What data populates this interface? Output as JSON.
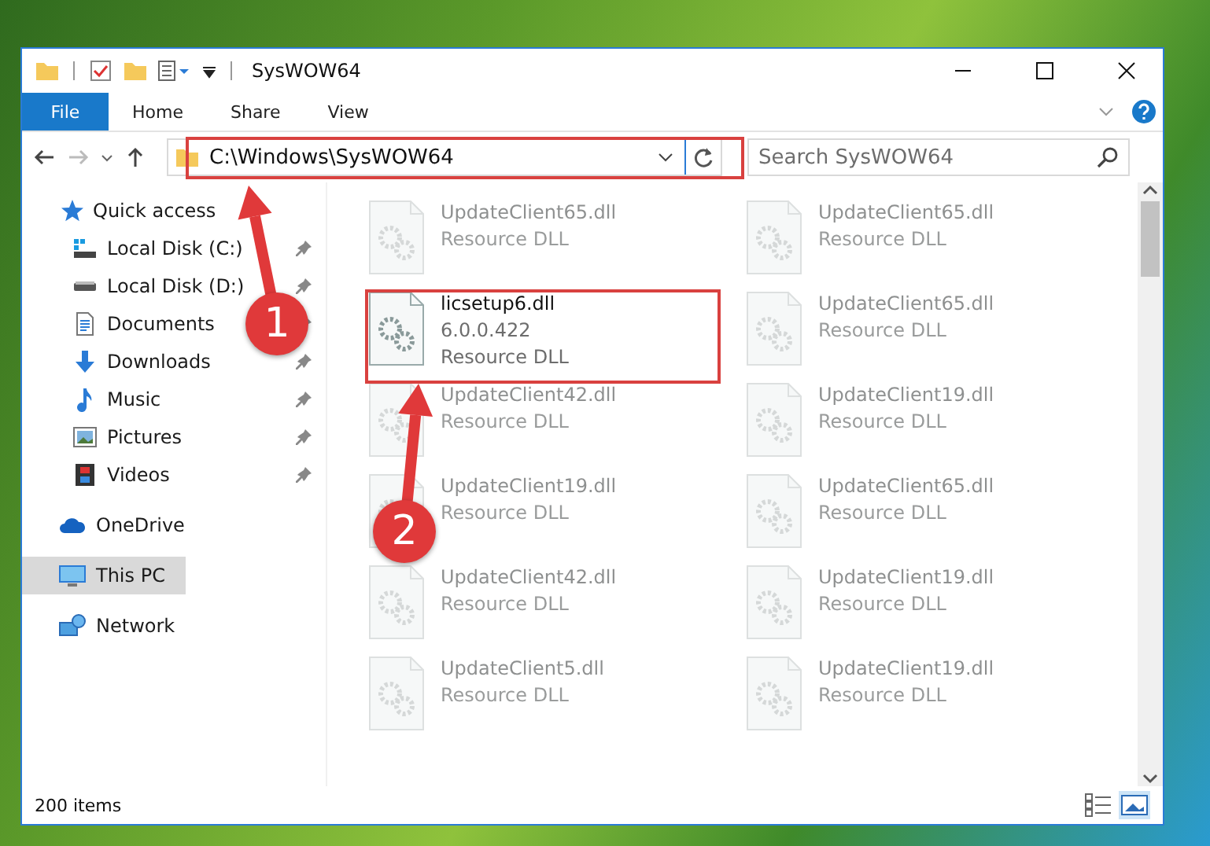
{
  "window": {
    "title": "SysWOW64"
  },
  "ribbon_tabs": [
    {
      "label": "File",
      "kind": "file"
    },
    {
      "label": "Home",
      "kind": "tab"
    },
    {
      "label": "Share",
      "kind": "tab"
    },
    {
      "label": "View",
      "kind": "tab"
    }
  ],
  "address_bar": {
    "path": "C:\\Windows\\SysWOW64"
  },
  "search": {
    "placeholder": "Search SysWOW64"
  },
  "sidebar": {
    "items": [
      {
        "label": "Quick access",
        "kind": "quick-access",
        "selected": false,
        "children": [
          {
            "label": "Local Disk (C:)",
            "kind": "system-drive",
            "pinned": true
          },
          {
            "label": "Local Disk (D:)",
            "kind": "drive",
            "pinned": true
          },
          {
            "label": "Documents",
            "kind": "documents",
            "pinned": true
          },
          {
            "label": "Downloads",
            "kind": "downloads",
            "pinned": true
          },
          {
            "label": "Music",
            "kind": "music",
            "pinned": true
          },
          {
            "label": "Pictures",
            "kind": "pictures",
            "pinned": true
          },
          {
            "label": "Videos",
            "kind": "videos",
            "pinned": true
          }
        ]
      },
      {
        "label": "OneDrive",
        "kind": "cloud",
        "selected": false
      },
      {
        "label": "This PC",
        "kind": "pc",
        "selected": true
      },
      {
        "label": "Network",
        "kind": "network",
        "selected": false
      }
    ]
  },
  "files": [
    {
      "name": "UpdateClient65.dll",
      "type": "Resource DLL",
      "faded": true
    },
    {
      "name": "UpdateClient65.dll",
      "type": "Resource DLL",
      "faded": true
    },
    {
      "name": "licsetup6.dll",
      "version": "6.0.0.422",
      "type": "Resource DLL",
      "faded": false
    },
    {
      "name": "UpdateClient65.dll",
      "type": "Resource DLL",
      "faded": true
    },
    {
      "name": "UpdateClient42.dll",
      "type": "Resource DLL",
      "faded": true
    },
    {
      "name": "UpdateClient19.dll",
      "type": "Resource DLL",
      "faded": true
    },
    {
      "name": "UpdateClient19.dll",
      "type": "Resource DLL",
      "faded": true
    },
    {
      "name": "UpdateClient65.dll",
      "type": "Resource DLL",
      "faded": true
    },
    {
      "name": "UpdateClient42.dll",
      "type": "Resource DLL",
      "faded": true
    },
    {
      "name": "UpdateClient19.dll",
      "type": "Resource DLL",
      "faded": true
    },
    {
      "name": "UpdateClient5.dll",
      "type": "Resource DLL",
      "faded": true
    },
    {
      "name": "UpdateClient19.dll",
      "type": "Resource DLL",
      "faded": true
    }
  ],
  "status_bar": {
    "item_count": "200 items"
  },
  "annotations": [
    {
      "number": "1"
    },
    {
      "number": "2"
    }
  ]
}
